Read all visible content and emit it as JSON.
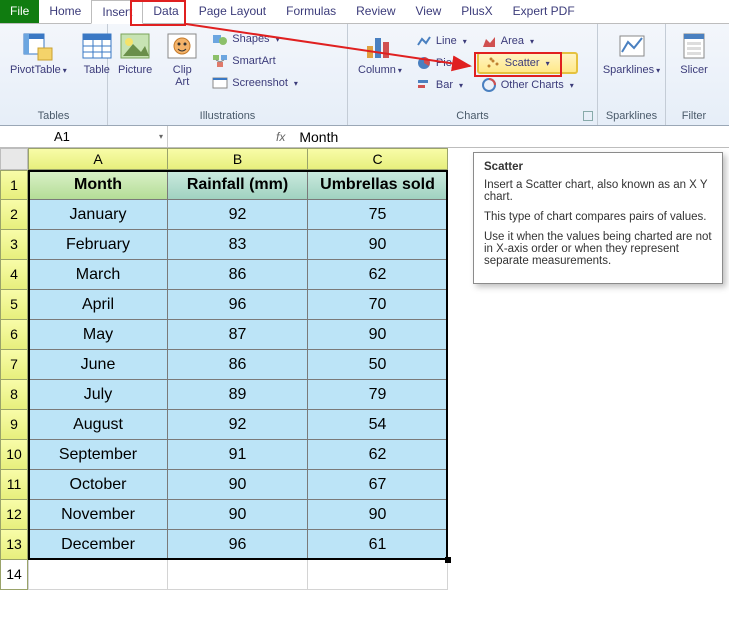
{
  "tabs": {
    "file": "File",
    "items": [
      "Home",
      "Insert",
      "Data",
      "Page Layout",
      "Formulas",
      "Review",
      "View",
      "PlusX",
      "Expert PDF"
    ],
    "active": "Insert"
  },
  "ribbon": {
    "tables": {
      "pivot": "PivotTable",
      "table": "Table",
      "label": "Tables"
    },
    "illus": {
      "picture": "Picture",
      "clip": "Clip\nArt",
      "shapes": "Shapes",
      "smartart": "SmartArt",
      "screenshot": "Screenshot",
      "label": "Illustrations"
    },
    "charts": {
      "column": "Column",
      "line": "Line",
      "pie": "Pie",
      "bar": "Bar",
      "area": "Area",
      "scatter": "Scatter",
      "other": "Other Charts",
      "label": "Charts"
    },
    "spark": {
      "label1": "Sparklines",
      "label2": "Sparklines"
    },
    "filter": {
      "slicer": "Slicer",
      "label": "Filter"
    }
  },
  "tooltip": {
    "title": "Scatter",
    "p1": "Insert a Scatter chart, also known as an X Y chart.",
    "p2": "This type of chart compares pairs of values.",
    "p3": "Use it when the values being charted are not in X-axis order or when they represent separate measurements."
  },
  "namebox": "A1",
  "formula": "Month",
  "grid": {
    "cols": [
      "A",
      "B",
      "C"
    ],
    "headers": [
      "Month",
      "Rainfall (mm)",
      "Umbrellas sold"
    ],
    "rows": [
      [
        "January",
        "92",
        "75"
      ],
      [
        "February",
        "83",
        "90"
      ],
      [
        "March",
        "86",
        "62"
      ],
      [
        "April",
        "96",
        "70"
      ],
      [
        "May",
        "87",
        "90"
      ],
      [
        "June",
        "86",
        "50"
      ],
      [
        "July",
        "89",
        "79"
      ],
      [
        "August",
        "92",
        "54"
      ],
      [
        "September",
        "91",
        "62"
      ],
      [
        "October",
        "90",
        "67"
      ],
      [
        "November",
        "90",
        "90"
      ],
      [
        "December",
        "96",
        "61"
      ]
    ]
  },
  "chart_data": {
    "type": "table",
    "categories": [
      "January",
      "February",
      "March",
      "April",
      "May",
      "June",
      "July",
      "August",
      "September",
      "October",
      "November",
      "December"
    ],
    "series": [
      {
        "name": "Rainfall (mm)",
        "values": [
          92,
          83,
          86,
          96,
          87,
          86,
          89,
          92,
          91,
          90,
          90,
          96
        ]
      },
      {
        "name": "Umbrellas sold",
        "values": [
          75,
          90,
          62,
          70,
          90,
          50,
          79,
          54,
          62,
          67,
          90,
          61
        ]
      }
    ]
  }
}
